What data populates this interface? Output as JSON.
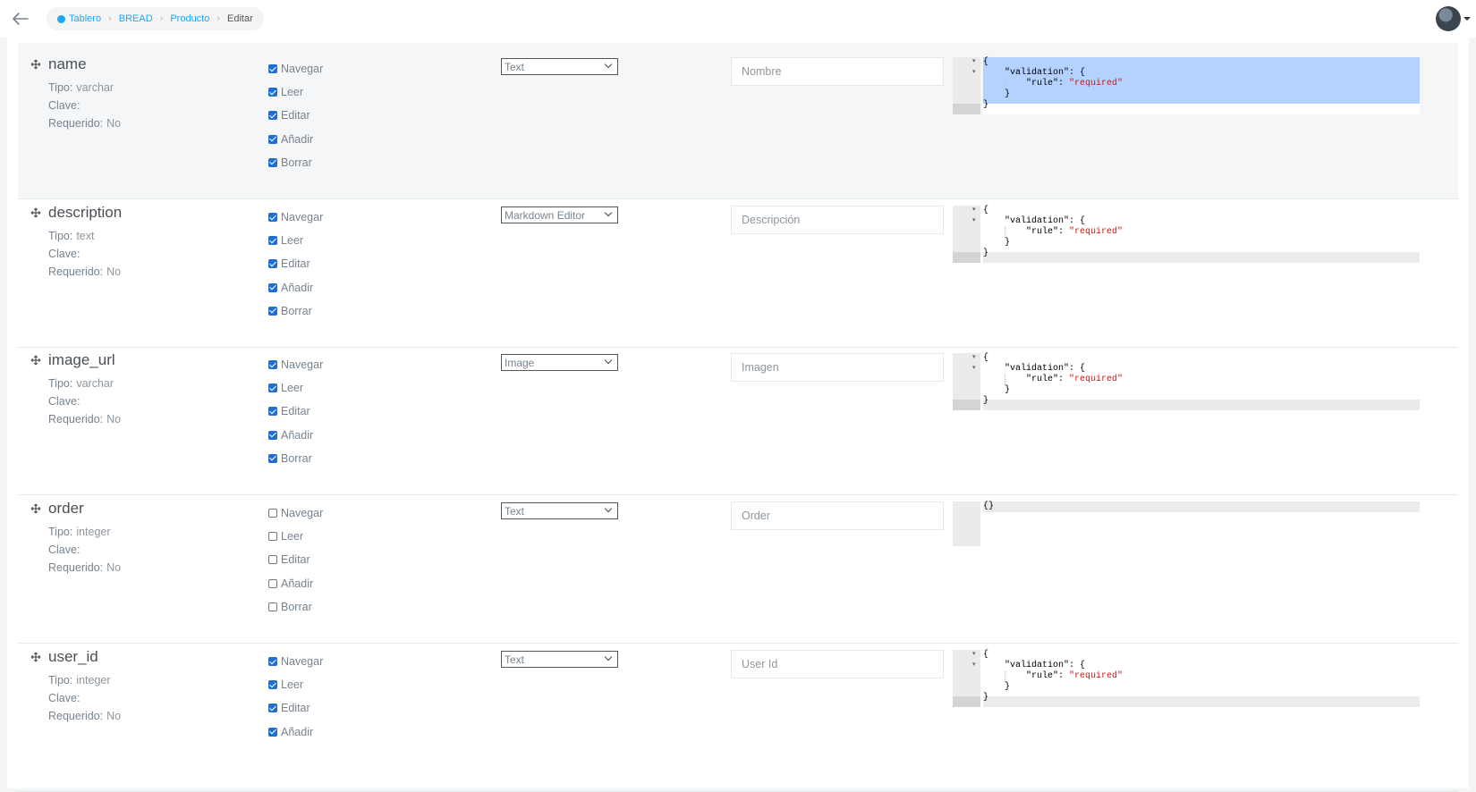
{
  "topbar": {
    "breadcrumbs": [
      "Tablero",
      "BREAD",
      "Producto",
      "Editar"
    ]
  },
  "labels": {
    "tipo": "Tipo:",
    "clave": "Clave:",
    "requerido": "Requerido:"
  },
  "fields": [
    {
      "name": "name",
      "tipo": "varchar",
      "clave": "",
      "requerido": "No",
      "checks": [
        {
          "label": "Navegar",
          "checked": true
        },
        {
          "label": "Leer",
          "checked": true
        },
        {
          "label": "Editar",
          "checked": true
        },
        {
          "label": "Añadir",
          "checked": true
        },
        {
          "label": "Borrar",
          "checked": true
        }
      ],
      "type": "Text",
      "display_name": "Nombre",
      "json": [
        "{",
        "    \"validation\": {",
        "        \"rule\": ",
        "\"required\"",
        "    }",
        "}"
      ]
    },
    {
      "name": "description",
      "tipo": "text",
      "clave": "",
      "requerido": "No",
      "checks": [
        {
          "label": "Navegar",
          "checked": true
        },
        {
          "label": "Leer",
          "checked": true
        },
        {
          "label": "Editar",
          "checked": true
        },
        {
          "label": "Añadir",
          "checked": true
        },
        {
          "label": "Borrar",
          "checked": true
        }
      ],
      "type": "Markdown Editor",
      "display_name": "Descripción",
      "json": [
        "{",
        "    \"validation\": {",
        "        \"rule\": ",
        "\"required\"",
        "    }",
        "}"
      ]
    },
    {
      "name": "image_url",
      "tipo": "varchar",
      "clave": "",
      "requerido": "No",
      "checks": [
        {
          "label": "Navegar",
          "checked": true
        },
        {
          "label": "Leer",
          "checked": true
        },
        {
          "label": "Editar",
          "checked": true
        },
        {
          "label": "Añadir",
          "checked": true
        },
        {
          "label": "Borrar",
          "checked": true
        }
      ],
      "type": "Image",
      "display_name": "Imagen",
      "json": [
        "{",
        "    \"validation\": {",
        "        \"rule\": ",
        "\"required\"",
        "    }",
        "}"
      ]
    },
    {
      "name": "order",
      "tipo": "integer",
      "clave": "",
      "requerido": "No",
      "checks": [
        {
          "label": "Navegar",
          "checked": false
        },
        {
          "label": "Leer",
          "checked": false
        },
        {
          "label": "Editar",
          "checked": false
        },
        {
          "label": "Añadir",
          "checked": false
        },
        {
          "label": "Borrar",
          "checked": false
        }
      ],
      "type": "Text",
      "display_name": "Order",
      "json": [
        "{}"
      ]
    },
    {
      "name": "user_id",
      "tipo": "integer",
      "clave": "",
      "requerido": "No",
      "checks": [
        {
          "label": "Navegar",
          "checked": true
        },
        {
          "label": "Leer",
          "checked": true
        },
        {
          "label": "Editar",
          "checked": true
        },
        {
          "label": "Añadir",
          "checked": true
        }
      ],
      "type": "Text",
      "display_name": "User Id",
      "json": [
        "{",
        "    \"validation\": {",
        "        \"rule\": ",
        "\"required\"",
        "    }",
        "}"
      ]
    }
  ]
}
